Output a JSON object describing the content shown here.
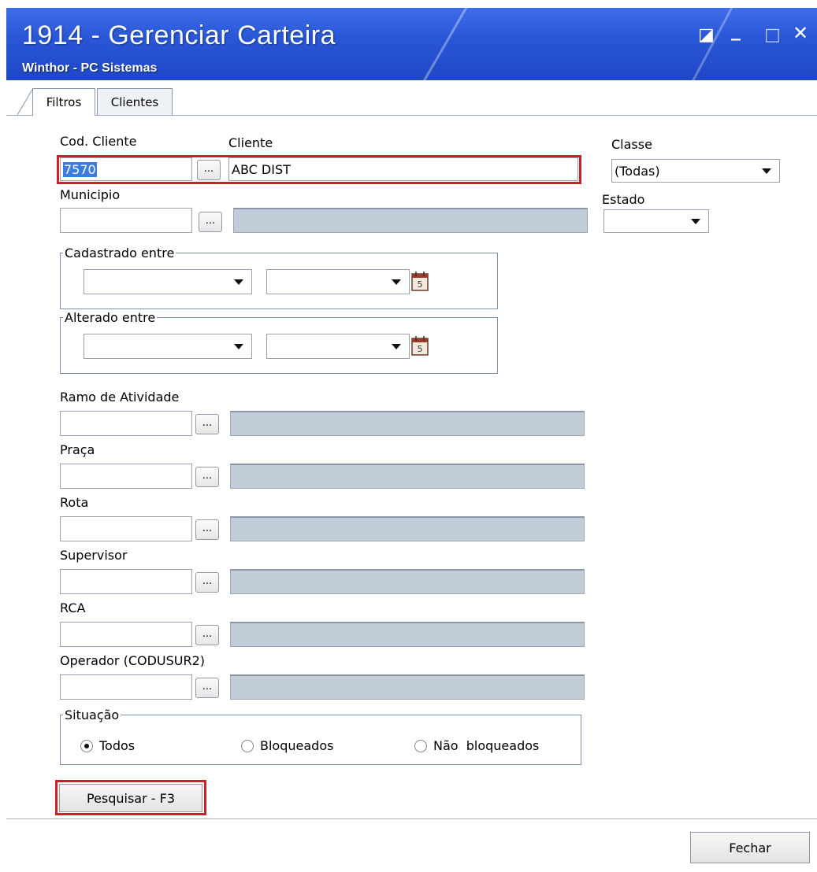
{
  "window": {
    "title": "1914 - Gerenciar Carteira",
    "subtitle": "Winthor - PC Sistemas",
    "controls": {
      "restore": "◪",
      "minimize": "_",
      "maximize": "□",
      "close": "✕"
    }
  },
  "tabs": [
    "Filtros",
    "Clientes"
  ],
  "filters": {
    "cod_cliente": {
      "label": "Cod. Cliente",
      "value": "7570"
    },
    "cliente": {
      "label": "Cliente",
      "value": "ABC DIST"
    },
    "classe": {
      "label": "Classe",
      "value": "(Todas)"
    },
    "municipio": {
      "label": "Municipio",
      "value": ""
    },
    "estado": {
      "label": "Estado",
      "value": ""
    },
    "cadastrado_entre": {
      "label": "Cadastrado entre"
    },
    "alterado_entre": {
      "label": "Alterado entre"
    },
    "ramo_atividade": {
      "label": "Ramo de Atividade"
    },
    "praca": {
      "label": "Praça"
    },
    "rota": {
      "label": "Rota"
    },
    "supervisor": {
      "label": "Supervisor"
    },
    "rca": {
      "label": "RCA"
    },
    "operador": {
      "label": "Operador (CODUSUR2)"
    },
    "lookup_button": "...",
    "situacao": {
      "label": "Situação",
      "options": [
        "Todos",
        "Bloqueados",
        "Não  bloqueados"
      ],
      "selected": "Todos"
    }
  },
  "buttons": {
    "search": "Pesquisar - F3",
    "close": "Fechar"
  },
  "colors": {
    "title_bar": "#2a57d8",
    "highlight_red": "#d01f27",
    "readonly_field": "#c3cdd9",
    "selection": "#3b7ce0"
  },
  "icons": [
    "restore-icon",
    "minimize-icon",
    "maximize-icon",
    "close-icon",
    "calendar-icon",
    "dropdown-arrow-icon"
  ]
}
